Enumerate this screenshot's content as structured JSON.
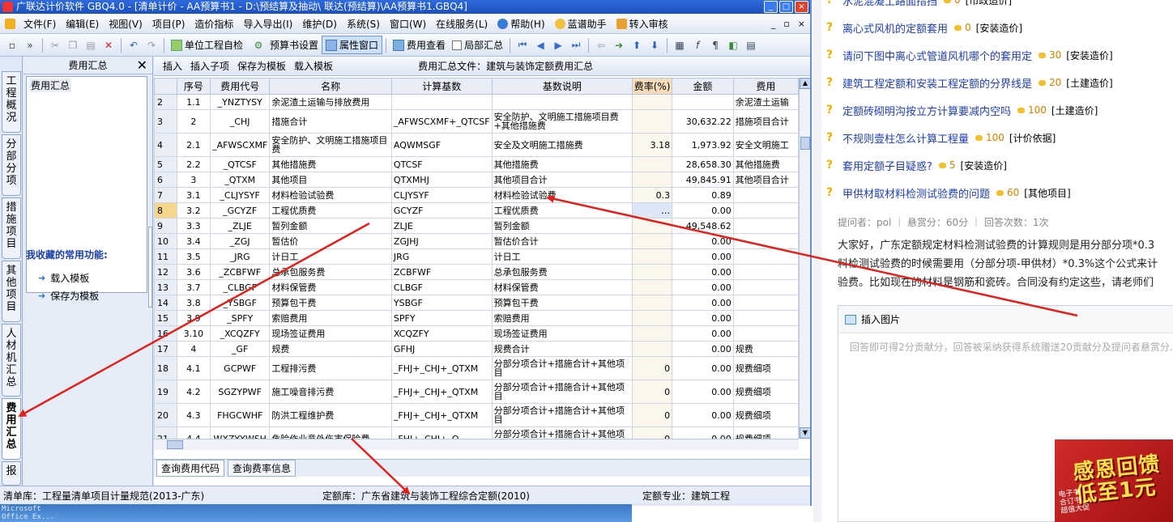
{
  "window": {
    "title": "广联达计价软件 GBQ4.0 - [清单计价 - AA预算书1 - D:\\预结算及抽动\\ 联达(预结算)\\AA预算书1.GBQ4]",
    "buttons": [
      "_",
      "□",
      "×"
    ]
  },
  "menu": {
    "items": [
      "文件(F)",
      "编辑(E)",
      "视图(V)",
      "项目(P)",
      "造价指标",
      "导入导出(I)",
      "维护(D)",
      "系统(S)",
      "窗口(W)",
      "在线服务(L)",
      "帮助(H)",
      "蓝谱助手",
      "转入审核"
    ],
    "window_controls": [
      "_",
      "▫",
      "×"
    ]
  },
  "toolbar": {
    "unit_check": "单位工程自检",
    "budget_settings": "预算书设置",
    "property_window": "属性窗口",
    "fee_view": "费用查看",
    "partial_summary": "局部汇总"
  },
  "vertical_tabs": [
    {
      "label": "工程概况"
    },
    {
      "label": "分部分项"
    },
    {
      "label": "措施项目"
    },
    {
      "label": "其他项目"
    },
    {
      "label": "人材机汇总"
    },
    {
      "label": "费用汇总"
    },
    {
      "label": "报"
    }
  ],
  "left_panel": {
    "title": "费用汇总",
    "close": "✕",
    "tree_node": "费用汇总",
    "favorites_title": "我收藏的常用功能:",
    "favorites": [
      "载入模板",
      "保存为模板"
    ]
  },
  "sub_toolbar": {
    "buttons": [
      "插入",
      "插入子项",
      "保存为模板",
      "载入模板"
    ],
    "file_label": "费用汇总文件：建筑与装饰定额费用汇总"
  },
  "grid": {
    "columns": [
      "",
      "序号",
      "费用代号",
      "名称",
      "计算基数",
      "基数说明",
      "费率(%)",
      "金额",
      "费用"
    ],
    "rows": [
      {
        "no": "2",
        "seq": "1.1",
        "code": "_YNZTYSY",
        "name": "余泥渣土运输与排放费用",
        "base": "",
        "desc": "",
        "rate": "",
        "amount": "",
        "type": "余泥渣土运输"
      },
      {
        "no": "3",
        "seq": "2",
        "code": "_CHJ",
        "name": "措施合计",
        "base": "_AFWSCXMF+_QTCSF",
        "desc": "安全防护、文明施工措施项目费+其他措施费",
        "rate": "",
        "amount": "30,632.22",
        "type": "措施项目合计"
      },
      {
        "no": "4",
        "seq": "2.1",
        "code": "_AFWSCXMF",
        "name": "安全防护、文明施工措施项目费",
        "base": "AQWMSGF",
        "desc": "安全及文明施工措施费",
        "rate": "3.18",
        "amount": "1,973.92",
        "type": "安全文明施工"
      },
      {
        "no": "5",
        "seq": "2.2",
        "code": "_QTCSF",
        "name": "其他措施费",
        "base": "QTCSF",
        "desc": "其他措施费",
        "rate": "",
        "amount": "28,658.30",
        "type": "其他措施费"
      },
      {
        "no": "6",
        "seq": "3",
        "code": "_QTXM",
        "name": "其他项目",
        "base": "QTXMHJ",
        "desc": "其他项目合计",
        "rate": "",
        "amount": "49,845.91",
        "type": "其他项目合计"
      },
      {
        "no": "7",
        "seq": "3.1",
        "code": "_CLJYSYF",
        "name": "材料检验试验费",
        "base": "CLJYSYF",
        "desc": "材料检验试验费",
        "rate": "0.3",
        "amount": "0.89",
        "type": ""
      },
      {
        "no": "8",
        "seq": "3.2",
        "code": "_GCYZF",
        "name": "工程优质费",
        "base": "GCYZF",
        "desc": "工程优质费",
        "rate": "…",
        "amount": "0.00",
        "type": ""
      },
      {
        "no": "9",
        "seq": "3.3",
        "code": "_ZLJE",
        "name": "暂列金额",
        "base": "ZLJE",
        "desc": "暂列金额",
        "rate": "",
        "amount": "49,548.62",
        "type": ""
      },
      {
        "no": "10",
        "seq": "3.4",
        "code": "_ZGJ",
        "name": "暂估价",
        "base": "ZGJHJ",
        "desc": "暂估价合计",
        "rate": "",
        "amount": "0.00",
        "type": ""
      },
      {
        "no": "11",
        "seq": "3.5",
        "code": "_JRG",
        "name": "计日工",
        "base": "JRG",
        "desc": "计日工",
        "rate": "",
        "amount": "0.00",
        "type": ""
      },
      {
        "no": "12",
        "seq": "3.6",
        "code": "_ZCBFWF",
        "name": "总承包服务费",
        "base": "ZCBFWF",
        "desc": "总承包服务费",
        "rate": "",
        "amount": "0.00",
        "type": ""
      },
      {
        "no": "13",
        "seq": "3.7",
        "code": "_CLBGF",
        "name": "材料保管费",
        "base": "CLBGF",
        "desc": "材料保管费",
        "rate": "",
        "amount": "0.00",
        "type": ""
      },
      {
        "no": "14",
        "seq": "3.8",
        "code": "_YSBGF",
        "name": "预算包干费",
        "base": "YSBGF",
        "desc": "预算包干费",
        "rate": "",
        "amount": "0.00",
        "type": ""
      },
      {
        "no": "15",
        "seq": "3.9",
        "code": "_SPFY",
        "name": "索赔费用",
        "base": "SPFY",
        "desc": "索赔费用",
        "rate": "",
        "amount": "0.00",
        "type": ""
      },
      {
        "no": "16",
        "seq": "3.10",
        "code": "_XCQZFY",
        "name": "现场签证费用",
        "base": "XCQZFY",
        "desc": "现场签证费用",
        "rate": "",
        "amount": "0.00",
        "type": ""
      },
      {
        "no": "17",
        "seq": "4",
        "code": "_GF",
        "name": "规费",
        "base": "GFHJ",
        "desc": "规费合计",
        "rate": "",
        "amount": "0.00",
        "type": "规费"
      },
      {
        "no": "18",
        "seq": "4.1",
        "code": "GCPWF",
        "name": "工程排污费",
        "base": "_FHJ+_CHJ+_QTXM",
        "desc": "分部分项合计+措施合计+其他项目",
        "rate": "0",
        "amount": "0.00",
        "type": "规费细项"
      },
      {
        "no": "19",
        "seq": "4.2",
        "code": "SGZYPWF",
        "name": "施工噪音排污费",
        "base": "_FHJ+_CHJ+_QTXM",
        "desc": "分部分项合计+措施合计+其他项目",
        "rate": "0",
        "amount": "0.00",
        "type": "规费细项"
      },
      {
        "no": "20",
        "seq": "4.3",
        "code": "FHGCWHF",
        "name": "防洪工程维护费",
        "base": "_FHJ+_CHJ+_QTXM",
        "desc": "分部分项合计+措施合计+其他项目",
        "rate": "0",
        "amount": "0.00",
        "type": "规费细项"
      },
      {
        "no": "21",
        "seq": "4.4",
        "code": "WXZYYWSH",
        "name": "危险作业意外伤害保险费",
        "base": "_FHJ+_CHJ+_Q",
        "desc": "分部分项合计+措施合计+其他项目",
        "rate": "0",
        "amount": "0.00",
        "type": "规费细项"
      }
    ]
  },
  "bottom_tabs": [
    "查询费用代码",
    "查询费率信息"
  ],
  "status": {
    "bill_lib": "清单库：工程量清单项目计量规范(2013-广东)",
    "quota_lib": "定额库：广东省建筑与装饰工程综合定额(2010)",
    "quota_major": "定额专业：建筑工程"
  },
  "taskbar": {
    "text": "Microsoft\nOffice Ex..."
  },
  "web": {
    "questions": [
      {
        "title": "水泥混凝土路面措挡",
        "reward": "0",
        "category": "[市政造价]"
      },
      {
        "title": "离心式风机的定额套用",
        "reward": "0",
        "category": "[安装造价]"
      },
      {
        "title": "请问下图中离心式管道风机哪个的套用定",
        "reward": "30",
        "category": "[安装造价]"
      },
      {
        "title": "建筑工程定额和安装工程定额的分界线是",
        "reward": "20",
        "category": "[土建造价]"
      },
      {
        "title": "定额砖砌明沟按立方计算要减内空吗",
        "reward": "100",
        "category": "[土建造价]"
      },
      {
        "title": "不规则壹柱怎么计算工程量",
        "reward": "100",
        "category": "[计价依据]"
      },
      {
        "title": "套用定额子目疑惑?",
        "reward": "5",
        "category": "[安装造价]"
      },
      {
        "title": "甲供材取材料检测试验费的问题",
        "reward": "60",
        "category": "[其他项目]"
      }
    ],
    "meta": "提问者：pol  ｜  悬赏分：60分  ｜  回答次数：1次",
    "body": [
      "大家好，广东定额规定材料检测试验费的计算规则是用分部分项*0.3",
      "料检测试验费的时候需要用（分部分项-甲供材）*0.3%这个公式来计",
      "验费。比如现在的材料是钢筋和瓷砖。合同没有约定这些，请老师们"
    ],
    "insert_image": "插入图片",
    "answer_placeholder": "回答即可得2分贡献分，回答被采纳获得系统赠送20贡献分及提问者悬赏分...",
    "ad_big": "感恩回馈\n低至1元",
    "ad_small": "电子书\n合订书\n超值大促"
  },
  "colors": {
    "title_bar": "#1b4fbe",
    "rate_header": "#f6dcb8",
    "arrow": "#e0201b",
    "link": "#1f3fb0"
  }
}
